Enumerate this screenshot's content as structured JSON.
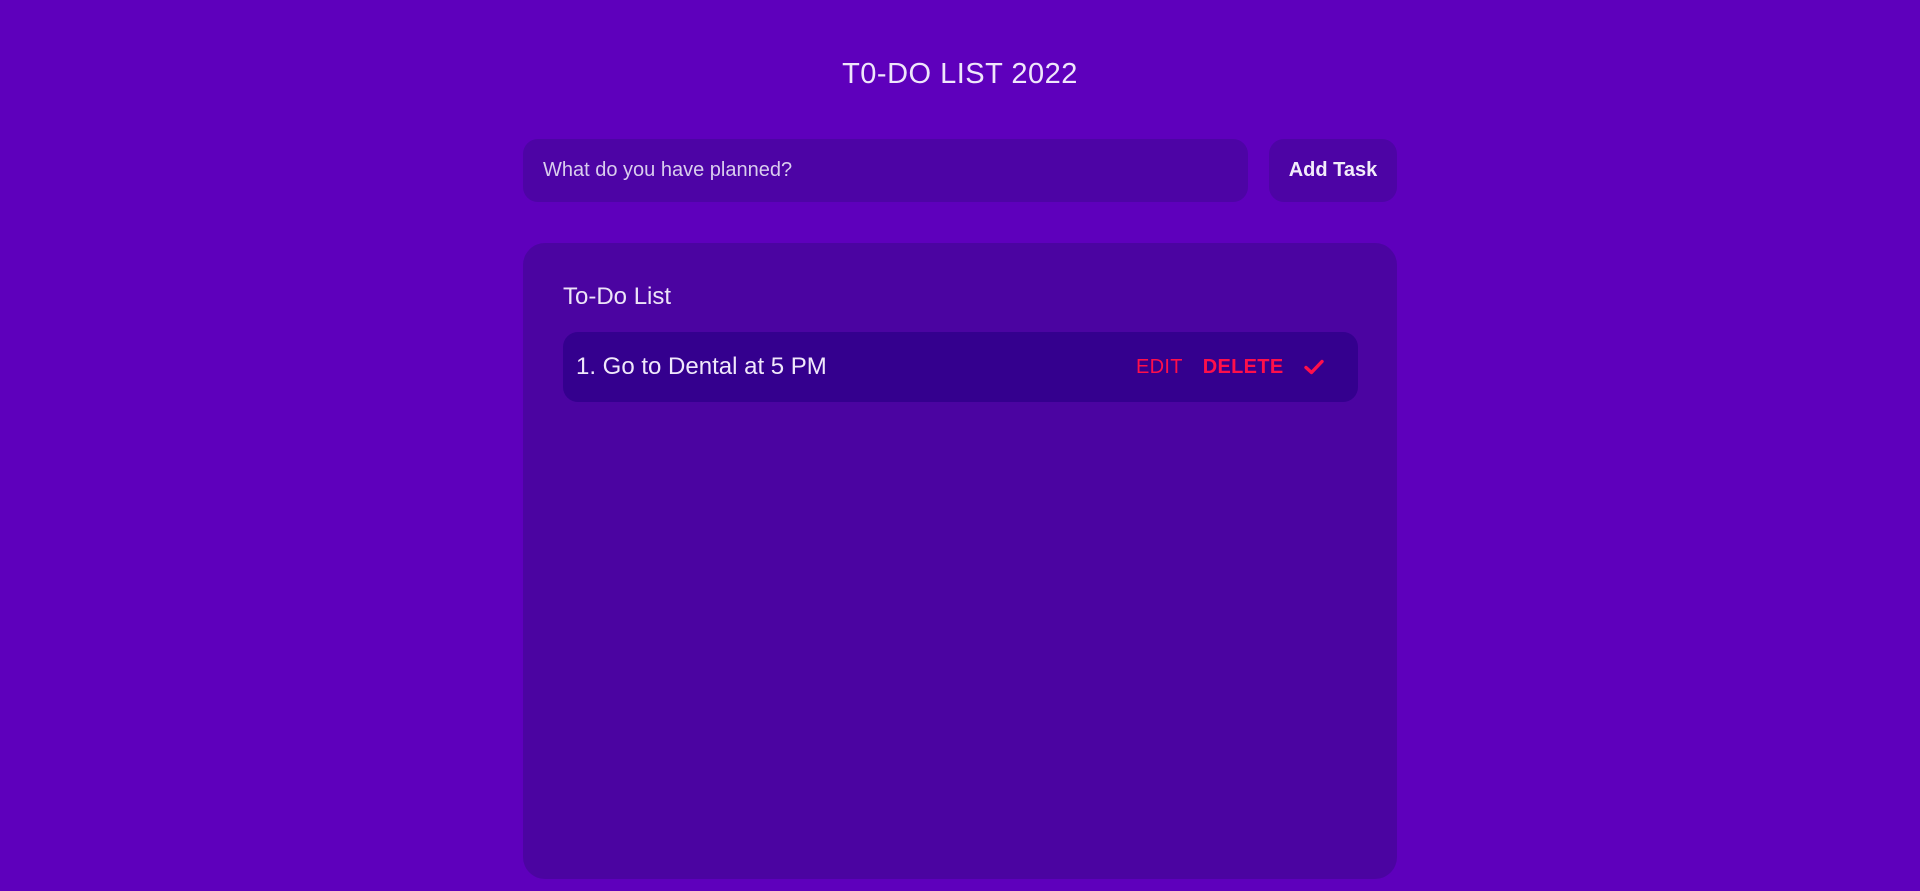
{
  "header": {
    "title": "T0-DO LIST 2022"
  },
  "form": {
    "input_value": "",
    "input_placeholder": "What do you have planned?",
    "add_label": "Add Task"
  },
  "list": {
    "heading": "To-Do List",
    "items": [
      {
        "text": "1. Go to Dental at 5 PM",
        "edit_label": "EDIT",
        "delete_label": "DELETE",
        "complete_icon": "check-icon"
      }
    ]
  },
  "colors": {
    "background": "#5e00bc",
    "panel": "#4b04a1",
    "input": "#4d04a5",
    "item": "#34008e",
    "action": "#ff0f4a"
  }
}
